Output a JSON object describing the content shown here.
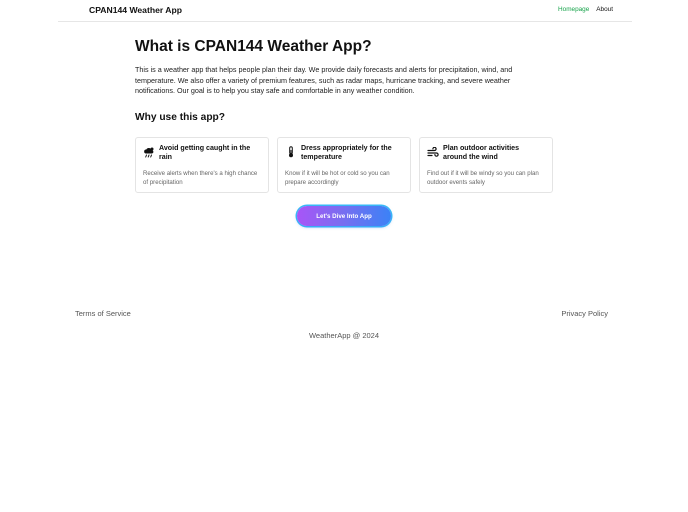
{
  "nav": {
    "brand": "CPAN144 Weather App",
    "links": [
      {
        "label": "Homepage",
        "active": true
      },
      {
        "label": "About",
        "active": false
      }
    ],
    "active_color": "#16a34a"
  },
  "main": {
    "title": "What is CPAN144 Weather App?",
    "intro": "This is a weather app that helps people plan their day. We provide daily forecasts and alerts for precipitation, wind, and temperature. We also offer a variety of premium features, such as radar maps, hurricane tracking, and severe weather notifications. Our goal is to help you stay safe and comfortable in any weather condition.",
    "why_title": "Why use this app?",
    "features": [
      {
        "icon": "cloud-rain-icon",
        "title": "Avoid getting caught in the rain",
        "description": "Receive alerts when there's a high chance of precipitation"
      },
      {
        "icon": "thermometer-icon",
        "title": "Dress appropriately for the temperature",
        "description": "Know if it will be hot or cold so you can prepare accordingly"
      },
      {
        "icon": "wind-icon",
        "title": "Plan outdoor activities around the wind",
        "description": "Find out if it will be windy so you can plan outdoor events safely"
      }
    ],
    "cta_label": "Let's Dive Into App",
    "cta_colors": [
      "#a855f7",
      "#3b82f6"
    ]
  },
  "footer": {
    "terms": "Terms of Service",
    "privacy": "Privacy Policy",
    "copyright": "WeatherApp @ 2024"
  }
}
